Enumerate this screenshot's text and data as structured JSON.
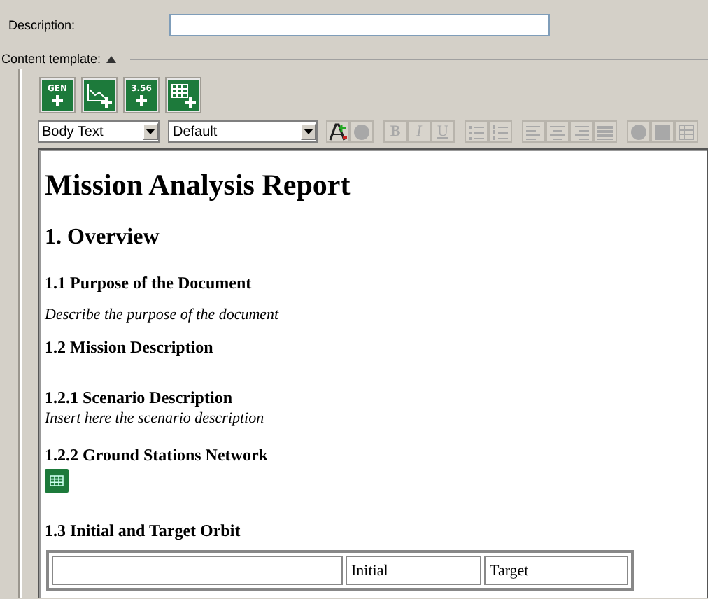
{
  "description": {
    "label": "Description:"
  },
  "content_template": {
    "label": "Content template:",
    "expanded": true
  },
  "insert_buttons": [
    {
      "kind": "gen",
      "text": "GEN"
    },
    {
      "kind": "chart"
    },
    {
      "kind": "number",
      "text": "3.56"
    },
    {
      "kind": "table"
    }
  ],
  "style_select": "Body Text",
  "font_select": "Default",
  "format_buttons": [
    {
      "kind": "font-color",
      "disabled": false
    },
    {
      "kind": "highlight",
      "disabled": true
    },
    {
      "kind": "bold",
      "text": "B",
      "disabled": true
    },
    {
      "kind": "italic",
      "text": "I",
      "disabled": true
    },
    {
      "kind": "underline",
      "text": "U",
      "disabled": true
    },
    {
      "kind": "bullets",
      "disabled": true
    },
    {
      "kind": "numbering",
      "disabled": true
    },
    {
      "kind": "align-left",
      "disabled": true
    },
    {
      "kind": "align-center",
      "disabled": true
    },
    {
      "kind": "align-right",
      "disabled": true
    },
    {
      "kind": "justify",
      "disabled": true
    },
    {
      "kind": "circle",
      "disabled": true
    },
    {
      "kind": "image",
      "disabled": true
    },
    {
      "kind": "table",
      "disabled": true
    }
  ],
  "document": [
    {
      "kind": "title",
      "text": "Mission Analysis Report"
    },
    {
      "kind": "h1",
      "text": "1. Overview"
    },
    {
      "kind": "h3",
      "text": "1.1 Purpose of the Document"
    },
    {
      "kind": "note",
      "text": "Describe the purpose of the document"
    },
    {
      "kind": "h3",
      "text": "1.2 Mission Description"
    },
    {
      "kind": "h3",
      "text": "1.2.1 Scenario Description"
    },
    {
      "kind": "note",
      "text": "Insert here the scenario description"
    },
    {
      "kind": "h3",
      "text": "1.2.2 Ground Stations Network"
    },
    {
      "kind": "table-icon"
    },
    {
      "kind": "h3",
      "text": "1.3 Initial and Target Orbit"
    },
    {
      "kind": "table",
      "rows": [
        [
          {},
          {
            "text": "Initial"
          },
          {
            "text": "Target"
          }
        ]
      ]
    }
  ]
}
